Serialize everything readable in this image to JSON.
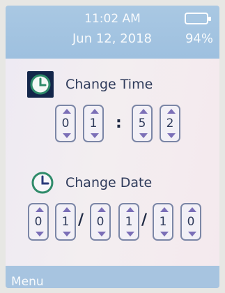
{
  "status": {
    "time": "11:02 AM",
    "date": "Jun 12, 2018",
    "battery": "94%"
  },
  "change_time": {
    "label": "Change Time",
    "digits": [
      "0",
      "1",
      "5",
      "2"
    ],
    "separator": ":"
  },
  "change_date": {
    "label": "Change Date",
    "digits": [
      "0",
      "1",
      "0",
      "1",
      "1",
      "0"
    ],
    "separator": "/"
  },
  "menu": {
    "label": "Menu"
  },
  "colors": {
    "status_bar": "#a9c8e3",
    "accent_green": "#2f8b6a",
    "arrow": "#7b6fb7",
    "icon_bg": "#13264a"
  },
  "icons": {
    "time": "clock-icon",
    "date": "clock-icon",
    "battery": "battery-icon"
  }
}
